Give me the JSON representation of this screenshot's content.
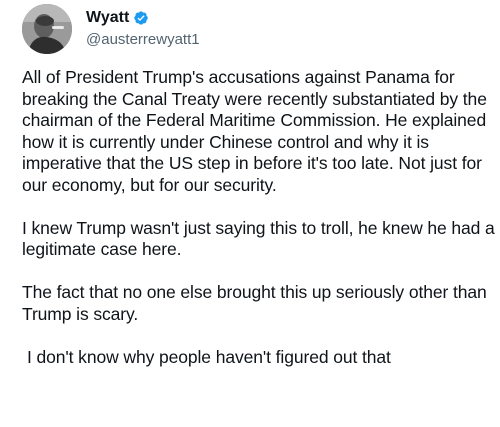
{
  "author": {
    "display_name": "Wyatt",
    "handle": "@austerrewyatt1",
    "verified_color": "#1d9bf0",
    "avatar_icon": "profile-photo"
  },
  "tweet": {
    "paragraphs": [
      "All of President Trump's accusations against Panama for breaking the Canal Treaty were recently substantiated by the chairman of the Federal Maritime Commission. He explained how it is currently under Chinese control and why it is imperative that the US step in before it's too late. Not just for our economy, but for our security.",
      "I knew Trump wasn't just saying this to troll, he knew he had a legitimate case here.",
      "The fact that no one else brought this up seriously other than Trump is scary.",
      "I don't know why people haven't figured out that"
    ]
  }
}
